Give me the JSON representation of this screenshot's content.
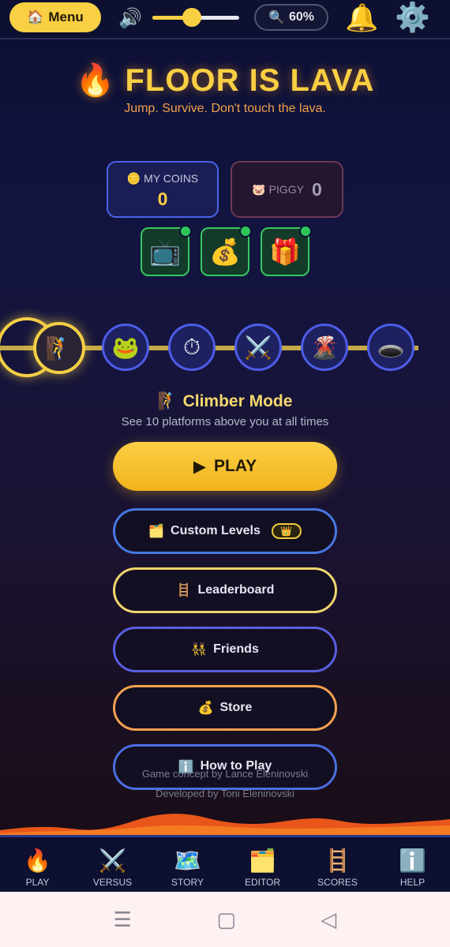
{
  "topbar": {
    "menu_icon": "🏠",
    "menu_label": "Menu",
    "speaker_icon": "🔊",
    "volume": 0.45,
    "zoom_icon": "🔍",
    "zoom_label": "60%",
    "bell_icon": "🔔",
    "gear_icon": "⚙️"
  },
  "header": {
    "title_icon": "🔥",
    "title": "FLOOR IS LAVA",
    "subtitle": "Jump. Survive. Don't touch the lava."
  },
  "wallet": {
    "coins_icon": "🪙",
    "coins_label": "MY COINS",
    "coins_value": "0",
    "piggy_icon": "🐷",
    "piggy_label": "PIGGY",
    "piggy_value": "0"
  },
  "rewards": [
    {
      "icon": "📺",
      "name": "tv-reward"
    },
    {
      "icon": "💰",
      "name": "money-bag-reward"
    },
    {
      "icon": "🎁",
      "name": "gift-reward"
    }
  ],
  "modes": [
    {
      "icon": "🧗",
      "name": "climber"
    },
    {
      "icon": "🐸",
      "name": "frog"
    },
    {
      "icon": "⏱",
      "name": "stopwatch"
    },
    {
      "icon": "⚔️",
      "name": "swords"
    },
    {
      "icon": "🌋",
      "name": "volcano"
    },
    {
      "icon": "🕳️",
      "name": "hole"
    }
  ],
  "selected_mode": {
    "icon": "🧗",
    "title": "Climber Mode",
    "description": "See 10 platforms above you at all times"
  },
  "buttons": {
    "play_icon": "▶",
    "play_label": "PLAY",
    "custom_icon": "🗂️",
    "custom_label": "Custom Levels",
    "custom_badge": "👑",
    "leaderboard_icon": "🪜",
    "leaderboard_label": "Leaderboard",
    "friends_icon": "👯",
    "friends_label": "Friends",
    "store_icon": "💰",
    "store_label": "Store",
    "how_icon": "ℹ️",
    "how_label": "How to Play"
  },
  "credits": {
    "line1": "Game concept by Lance Eleninovski",
    "line2": "Developed by Toni Eleninovski"
  },
  "bottom_nav": [
    {
      "icon": "🔥",
      "label": "PLAY"
    },
    {
      "icon": "⚔️",
      "label": "VERSUS"
    },
    {
      "icon": "🗺️",
      "label": "STORY"
    },
    {
      "icon": "🗂️",
      "label": "EDITOR"
    },
    {
      "icon": "🪜",
      "label": "SCORES"
    },
    {
      "icon": "ℹ️",
      "label": "HELP"
    }
  ],
  "system_nav": {
    "menu_icon": "☰",
    "home_icon": "▢",
    "back_icon": "◁"
  },
  "colors": {
    "accent": "#f9cf43",
    "lava": "#f26a1b",
    "blue_border": "#4b63e8",
    "green_border": "#34c95e"
  }
}
